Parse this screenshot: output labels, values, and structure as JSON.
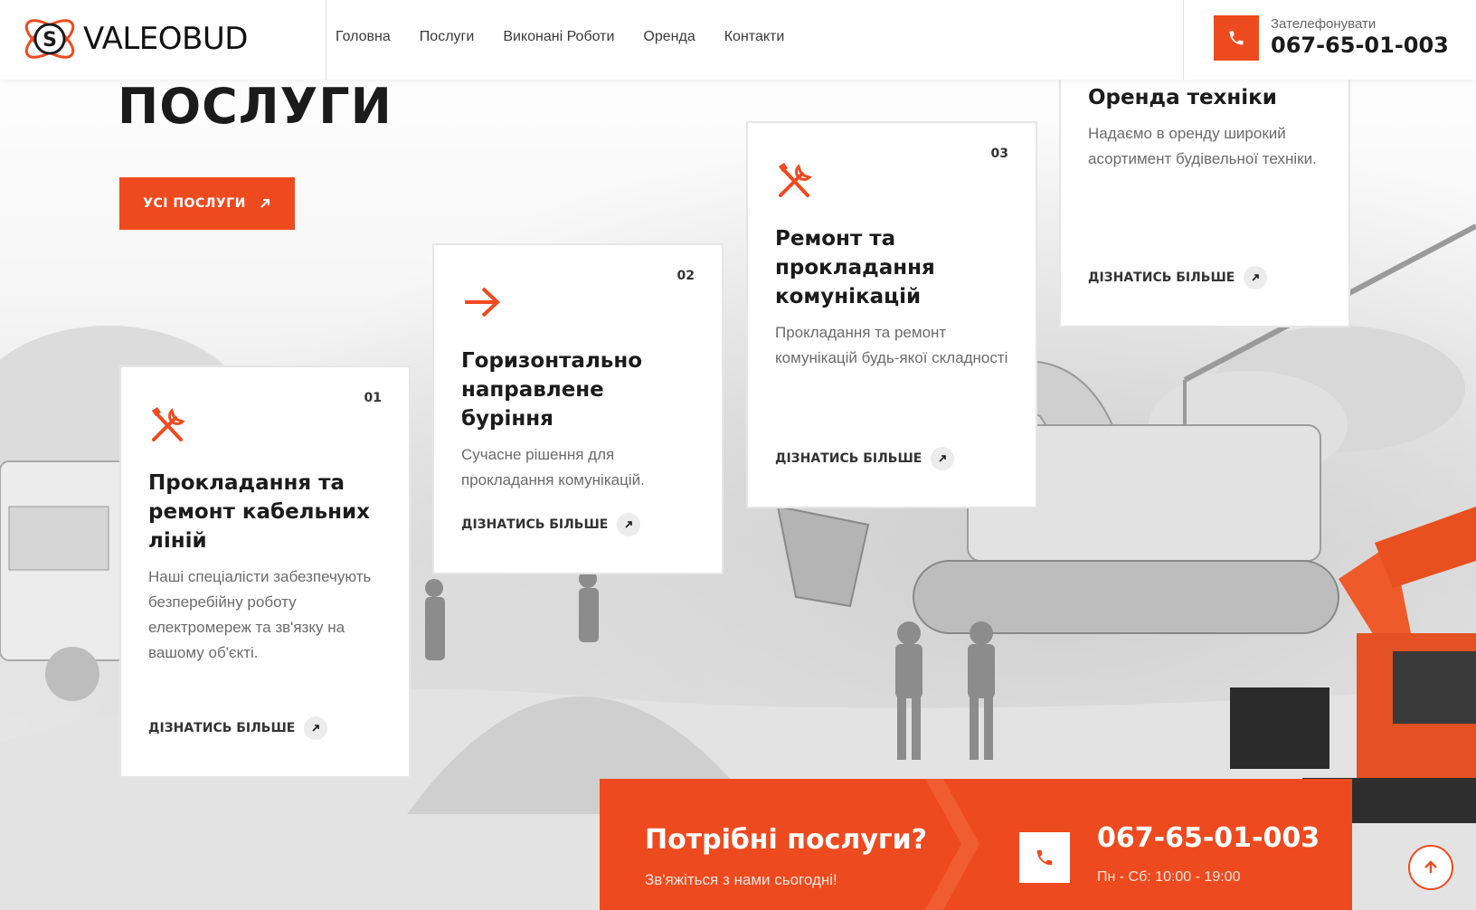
{
  "header": {
    "logo_text": "VALEOBUD",
    "logo_letter": "S",
    "nav": [
      "Головна",
      "Послуги",
      "Виконані Роботи",
      "Оренда",
      "Контакти"
    ],
    "call_label": "Зателефонувати",
    "call_number": "067-65-01-003"
  },
  "main": {
    "title": "ПОСЛУГИ",
    "all_services_label": "УСІ ПОСЛУГИ",
    "cards": [
      {
        "num": "01",
        "icon": "tools-icon",
        "title": "Прокладання та ремонт кабельних ліній",
        "desc": "Наші спеціалісти забезпечують безперебійну роботу електромереж та зв'язку на вашому об'єкті.",
        "more": "ДІЗНАТИСЬ БІЛЬШЕ"
      },
      {
        "num": "02",
        "icon": "arrow-right-icon",
        "title": "Горизонтально направлене буріння",
        "desc": "Сучасне рішення для прокладання комунікацій.",
        "more": "ДІЗНАТИСЬ БІЛЬШЕ"
      },
      {
        "num": "03",
        "icon": "tools-icon",
        "title": "Ремонт та прокладання комунікацій",
        "desc": "Прокладання та ремонт комунікацій будь-якої складності",
        "more": "ДІЗНАТИСЬ БІЛЬШЕ"
      },
      {
        "num": "",
        "icon": "",
        "title": "Оренда техніки",
        "desc": "Надаємо в оренду широкий асортимент будівельної техніки.",
        "more": "ДІЗНАТИСЬ БІЛЬШЕ"
      }
    ]
  },
  "cta": {
    "title": "Потрібні послуги?",
    "subtitle": "Зв'яжіться з нами сьогодні!",
    "phone": "067-65-01-003",
    "hours": "Пн - Сб: 10:00 - 19:00"
  },
  "colors": {
    "accent": "#ee4a1f",
    "text_dark": "#1b1b1b",
    "text_muted": "#6b6b6b"
  }
}
